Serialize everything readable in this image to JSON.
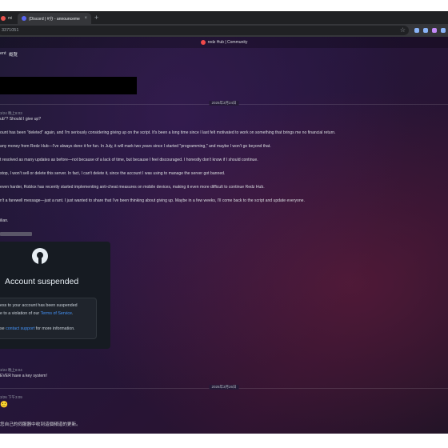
{
  "browser": {
    "tabs": [
      {
        "label": "mi",
        "active": false
      },
      {
        "label": "(Discord | #分 - announceme",
        "active": true
      }
    ],
    "new_tab_glyph": "+",
    "tab_close_glyph": "×",
    "url": "3371051",
    "bookmark_icon": "star-icon",
    "extension_colors": [
      "#8ab4f8",
      "#8ab4f8",
      "#c58af9",
      "#8ab4f8"
    ]
  },
  "app": {
    "server_title": "redz Hub | Community",
    "channel_header": {
      "left": "ent",
      "right": "概覽"
    }
  },
  "dividers": [
    "2025年3月24日",
    "2025年3月26日"
  ],
  "messages": [
    {
      "type": "meta",
      "text": "3/24 晚上8:03"
    },
    {
      "type": "text",
      "text": "ub\"? Should I give up?"
    },
    {
      "type": "text",
      "text": "ount has been \"deleted\" again, and I'm seriously considering giving up on the script. It's been a long time since I last felt motivated to work on something that brings me no financial return."
    },
    {
      "type": "text",
      "text": "any money from Redz Hub—I've always done it for fun. In July, it will mark two years since I started \"programming,\" and maybe I won't go beyond that."
    },
    {
      "type": "text",
      "text": "t resolved as many updates as before—not because of a lack of time, but because I feel discouraged. I honestly don't know if I should continue."
    },
    {
      "type": "text",
      "text": "stop, I won't sell or delete this server. In fact, I can't delete it, since the account I was using to manage the server got banned."
    },
    {
      "type": "text",
      "text": "even harder, Roblox has recently started implementing anti-cheat measures on mobile devices, making it even more difficult to continue Redz Hub."
    },
    {
      "type": "text",
      "text": "n't a farewell message—just a rant. I just wanted to share that I've been thinking about giving up. Maybe in a few weeks, I'll come back to the script and update everyone."
    },
    {
      "type": "text",
      "text": "ilian."
    }
  ],
  "github_embed": {
    "title": "Account suspended",
    "line1": "ess to your account has been suspended",
    "line2_prefix": "e to a violation of our ",
    "line2_link": "Terms of Service",
    "line2_suffix": ".",
    "line3_prefix": "se ",
    "line3_link": "contact support",
    "line3_suffix": " for more information."
  },
  "later_messages": [
    {
      "type": "meta",
      "text": "3/24 晚上8:04"
    },
    {
      "type": "text",
      "text": "EVER have a key system!"
    },
    {
      "type": "meta",
      "text": "3/26 下午3:09"
    },
    {
      "type": "emoji",
      "text": "🙂"
    }
  ],
  "composer": {
    "text": "您自己的伺服器中收到這個頻道的更新。"
  }
}
